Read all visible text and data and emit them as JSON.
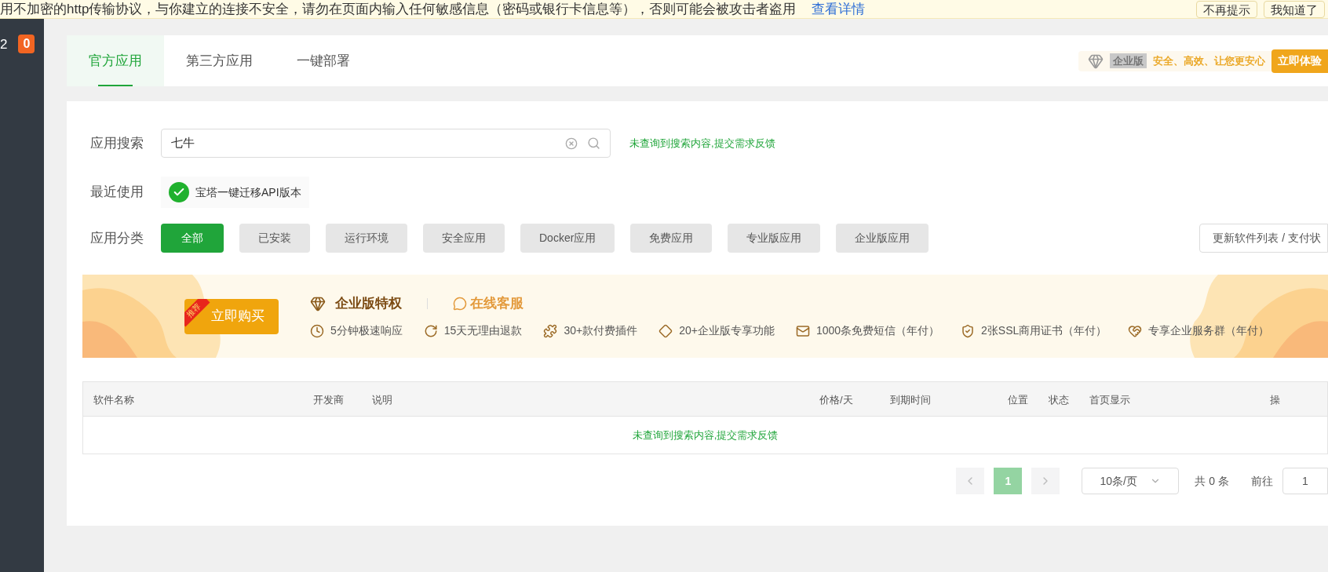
{
  "warning_bar": {
    "text": "用不加密的http传输协议，与你建立的连接不安全，请勿在页面内输入任何敏感信息（密码或银行卡信息等），否则可能会被攻击者盗用",
    "link": "查看详情",
    "buttons": [
      "不再提示",
      "我知道了"
    ]
  },
  "sidebar": {
    "label": "2",
    "badge": "0"
  },
  "tabs": [
    {
      "label": "官方应用",
      "selected": true
    },
    {
      "label": "第三方应用",
      "selected": false
    },
    {
      "label": "一键部署",
      "selected": false
    }
  ],
  "promo": {
    "edition": "企业版",
    "slogan": "安全、高效、让您更安心",
    "button": "立即体验"
  },
  "search": {
    "label": "应用搜索",
    "value": "七牛",
    "feedback": "未查询到搜索内容,提交需求反馈"
  },
  "recent": {
    "label": "最近使用",
    "items": [
      "宝塔一键迁移API版本"
    ]
  },
  "categories": {
    "label": "应用分类",
    "items": [
      {
        "label": "全部",
        "selected": true
      },
      {
        "label": "已安装",
        "selected": false
      },
      {
        "label": "运行环境",
        "selected": false
      },
      {
        "label": "安全应用",
        "selected": false
      },
      {
        "label": "Docker应用",
        "selected": false
      },
      {
        "label": "免费应用",
        "selected": false
      },
      {
        "label": "专业版应用",
        "selected": false
      },
      {
        "label": "企业版应用",
        "selected": false
      }
    ],
    "refresh_button": "更新软件列表 / 支付状"
  },
  "banner": {
    "ribbon": "推荐",
    "buy_button": "立即购买",
    "title": "企业版特权",
    "service": "在线客服",
    "features": [
      "5分钟极速响应",
      "15天无理由退款",
      "30+款付费插件",
      "20+企业版专享功能",
      "1000条免费短信（年付）",
      "2张SSL商用证书（年付）",
      "专享企业服务群（年付）"
    ]
  },
  "table": {
    "columns": [
      "软件名称",
      "开发商",
      "说明",
      "价格/天",
      "到期时间",
      "位置",
      "状态",
      "首页显示",
      "操"
    ],
    "empty_text": "未查询到搜索内容,提交需求反馈"
  },
  "pagination": {
    "page": "1",
    "page_size": "10条/页",
    "total": "共 0 条",
    "goto_label": "前往",
    "goto_value": "1"
  }
}
